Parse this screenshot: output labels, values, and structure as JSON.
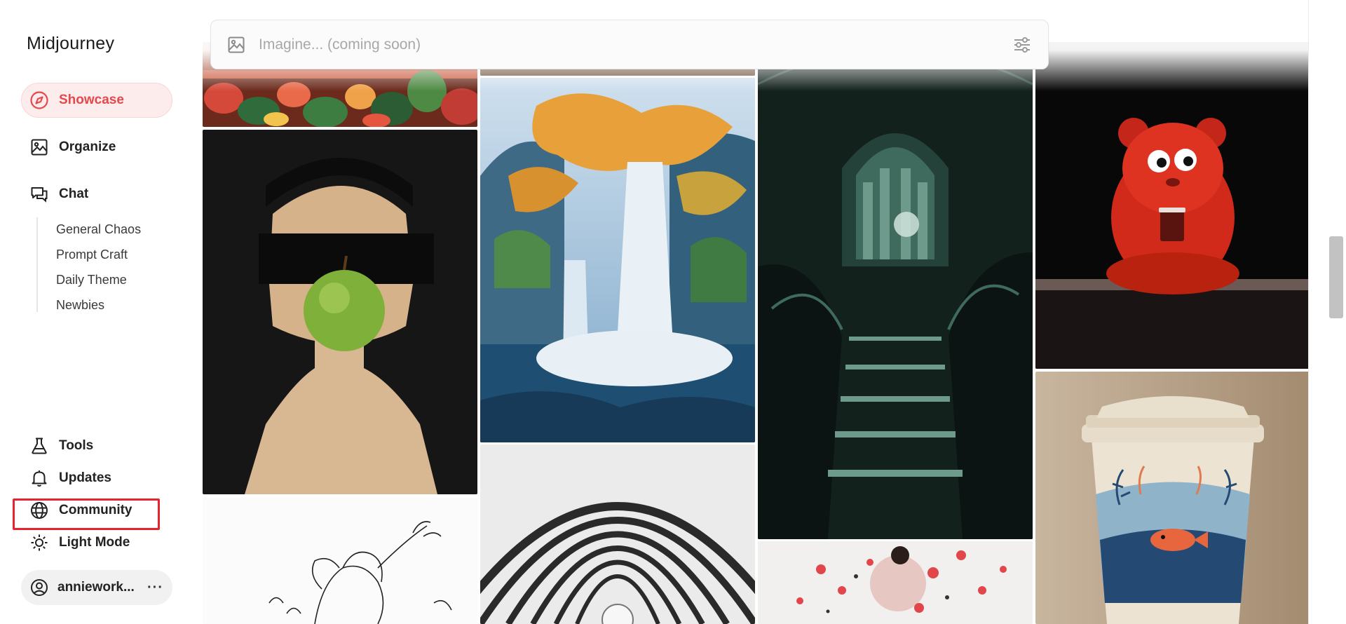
{
  "app": {
    "brand": "Midjourney"
  },
  "sidebar": {
    "nav": [
      {
        "label": "Showcase",
        "icon": "compass-icon",
        "active": true
      },
      {
        "label": "Organize",
        "icon": "image-icon"
      },
      {
        "label": "Chat",
        "icon": "chat-icon"
      }
    ],
    "chat_rooms": [
      "General Chaos",
      "Prompt Craft",
      "Daily Theme",
      "Newbies"
    ],
    "bottom_nav": [
      {
        "label": "Tools",
        "icon": "flask-icon"
      },
      {
        "label": "Updates",
        "icon": "bell-icon"
      },
      {
        "label": "Community",
        "icon": "globe-icon",
        "highlighted": true
      },
      {
        "label": "Light Mode",
        "icon": "sun-icon"
      }
    ],
    "user": {
      "name": "anniework...",
      "more": "···"
    }
  },
  "search": {
    "placeholder": "Imagine... (coming soon)",
    "value": ""
  },
  "gallery": {
    "tiles": [
      "painted flowers banner",
      "woman with green apple",
      "sketched flower drawing",
      "autumn waterfall painting",
      "white concentric arches",
      "gothic staircase with moon",
      "floating red flowers",
      "red fluffy bear with cup",
      "paper coffee cup with fish design"
    ]
  },
  "colors": {
    "accent": "#e5484d",
    "accent_bg": "#fdecec",
    "highlight_border": "#e8232d"
  }
}
